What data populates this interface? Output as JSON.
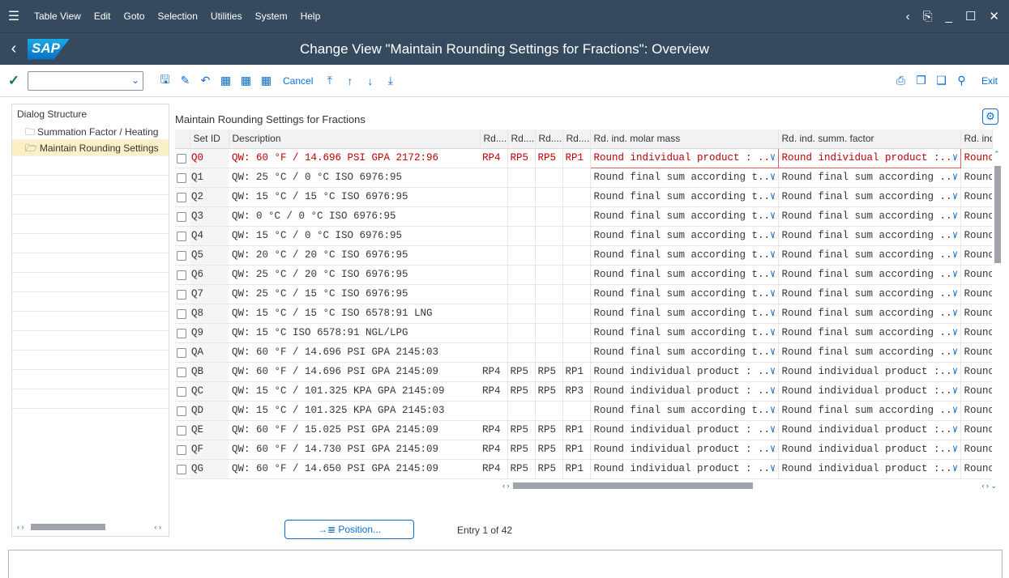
{
  "menubar": {
    "items": [
      "Table View",
      "Edit",
      "Goto",
      "Selection",
      "Utilities",
      "System",
      "Help"
    ]
  },
  "titlebar": {
    "title": "Change View \"Maintain Rounding Settings for Fractions\": Overview",
    "logo": "SAP"
  },
  "toolbar": {
    "cancel_label": "Cancel",
    "exit_label": "Exit"
  },
  "sidebar": {
    "header": "Dialog Structure",
    "items": [
      {
        "label": "Summation Factor / Heating"
      },
      {
        "label": "Maintain Rounding Settings"
      }
    ]
  },
  "main": {
    "title": "Maintain Rounding Settings for Fractions",
    "columns": [
      "Set ID",
      "Description",
      "Rd....",
      "Rd....",
      "Rd....",
      "Rd....",
      "Rd. ind. molar mass",
      "Rd. ind. summ. factor",
      "Rd. ind"
    ],
    "rows": [
      {
        "id": "Q0",
        "desc": "QW: 60 °F / 14.696 PSI GPA 2172:96",
        "r1": "RP4",
        "r2": "RP5",
        "r3": "RP5",
        "r4": "RP1",
        "molar": "Round individual product : ...",
        "summ": "Round individual product :...",
        "last": "Round"
      },
      {
        "id": "Q1",
        "desc": "QW: 25 °C / 0 °C ISO 6976:95",
        "r1": "",
        "r2": "",
        "r3": "",
        "r4": "",
        "molar": "Round final sum according t...",
        "summ": "Round final sum according ...",
        "last": "Round"
      },
      {
        "id": "Q2",
        "desc": "QW: 15 °C / 15 °C ISO 6976:95",
        "r1": "",
        "r2": "",
        "r3": "",
        "r4": "",
        "molar": "Round final sum according t...",
        "summ": "Round final sum according ...",
        "last": "Round"
      },
      {
        "id": "Q3",
        "desc": "QW: 0 °C / 0 °C ISO 6976:95",
        "r1": "",
        "r2": "",
        "r3": "",
        "r4": "",
        "molar": "Round final sum according t...",
        "summ": "Round final sum according ...",
        "last": "Round"
      },
      {
        "id": "Q4",
        "desc": "QW: 15 °C / 0 °C ISO 6976:95",
        "r1": "",
        "r2": "",
        "r3": "",
        "r4": "",
        "molar": "Round final sum according t...",
        "summ": "Round final sum according ...",
        "last": "Round"
      },
      {
        "id": "Q5",
        "desc": "QW: 20 °C / 20 °C ISO 6976:95",
        "r1": "",
        "r2": "",
        "r3": "",
        "r4": "",
        "molar": "Round final sum according t...",
        "summ": "Round final sum according ...",
        "last": "Round"
      },
      {
        "id": "Q6",
        "desc": "QW: 25 °C / 20 °C ISO 6976:95",
        "r1": "",
        "r2": "",
        "r3": "",
        "r4": "",
        "molar": "Round final sum according t...",
        "summ": "Round final sum according ...",
        "last": "Round"
      },
      {
        "id": "Q7",
        "desc": "QW: 25 °C / 15 °C ISO 6976:95",
        "r1": "",
        "r2": "",
        "r3": "",
        "r4": "",
        "molar": "Round final sum according t...",
        "summ": "Round final sum according ...",
        "last": "Round"
      },
      {
        "id": "Q8",
        "desc": "QW: 15 °C / 15 °C ISO 6578:91 LNG",
        "r1": "",
        "r2": "",
        "r3": "",
        "r4": "",
        "molar": "Round final sum according t...",
        "summ": "Round final sum according ...",
        "last": "Round"
      },
      {
        "id": "Q9",
        "desc": "QW: 15 °C ISO 6578:91 NGL/LPG",
        "r1": "",
        "r2": "",
        "r3": "",
        "r4": "",
        "molar": "Round final sum according t...",
        "summ": "Round final sum according ...",
        "last": "Round"
      },
      {
        "id": "QA",
        "desc": "QW: 60 °F / 14.696 PSI GPA 2145:03",
        "r1": "",
        "r2": "",
        "r3": "",
        "r4": "",
        "molar": "Round final sum according t...",
        "summ": "Round final sum according ...",
        "last": "Round"
      },
      {
        "id": "QB",
        "desc": "QW: 60 °F / 14.696 PSI GPA 2145:09",
        "r1": "RP4",
        "r2": "RP5",
        "r3": "RP5",
        "r4": "RP1",
        "molar": "Round individual product : ...",
        "summ": "Round individual product :...",
        "last": "Round"
      },
      {
        "id": "QC",
        "desc": "QW: 15 °C / 101.325 KPA GPA 2145:09",
        "r1": "RP4",
        "r2": "RP5",
        "r3": "RP5",
        "r4": "RP3",
        "molar": "Round individual product : ...",
        "summ": "Round individual product :...",
        "last": "Round"
      },
      {
        "id": "QD",
        "desc": "QW: 15 °C / 101.325 KPA GPA 2145:03",
        "r1": "",
        "r2": "",
        "r3": "",
        "r4": "",
        "molar": "Round final sum according t...",
        "summ": "Round final sum according ...",
        "last": "Round"
      },
      {
        "id": "QE",
        "desc": "QW: 60 °F / 15.025 PSI GPA 2145:09",
        "r1": "RP4",
        "r2": "RP5",
        "r3": "RP5",
        "r4": "RP1",
        "molar": "Round individual product : ...",
        "summ": "Round individual product :...",
        "last": "Round"
      },
      {
        "id": "QF",
        "desc": "QW: 60 °F / 14.730 PSI GPA 2145:09",
        "r1": "RP4",
        "r2": "RP5",
        "r3": "RP5",
        "r4": "RP1",
        "molar": "Round individual product : ...",
        "summ": "Round individual product :...",
        "last": "Round"
      },
      {
        "id": "QG",
        "desc": "QW: 60 °F / 14.650 PSI GPA 2145:09",
        "r1": "RP4",
        "r2": "RP5",
        "r3": "RP5",
        "r4": "RP1",
        "molar": "Round individual product : ...",
        "summ": "Round individual product :...",
        "last": "Round"
      }
    ]
  },
  "footer": {
    "position_label": "→≣ Position...",
    "entry_text": "Entry 1 of 42"
  },
  "colors": {
    "shell": "#354a5f",
    "accent": "#0a6ed1",
    "error": "#bb0000",
    "selected": "#fbf0c5"
  }
}
